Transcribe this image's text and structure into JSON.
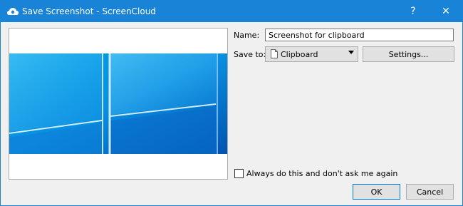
{
  "window": {
    "title": "Save Screenshot - ScreenCloud",
    "help_label": "?",
    "close_label": "✕",
    "accent": "#1883d7"
  },
  "form": {
    "name_label": "Name:",
    "name_value": "Screenshot for clipboard",
    "save_to_label": "Save to:",
    "save_to_selected": "Clipboard",
    "settings_label": "Settings...",
    "always_label": "Always do this and don't ask me again",
    "always_checked": false
  },
  "buttons": {
    "ok_label": "OK",
    "cancel_label": "Cancel"
  },
  "icons": {
    "app": "screencloud-icon",
    "clipboard": "document-icon",
    "dropdown": "chevron-down-icon"
  }
}
